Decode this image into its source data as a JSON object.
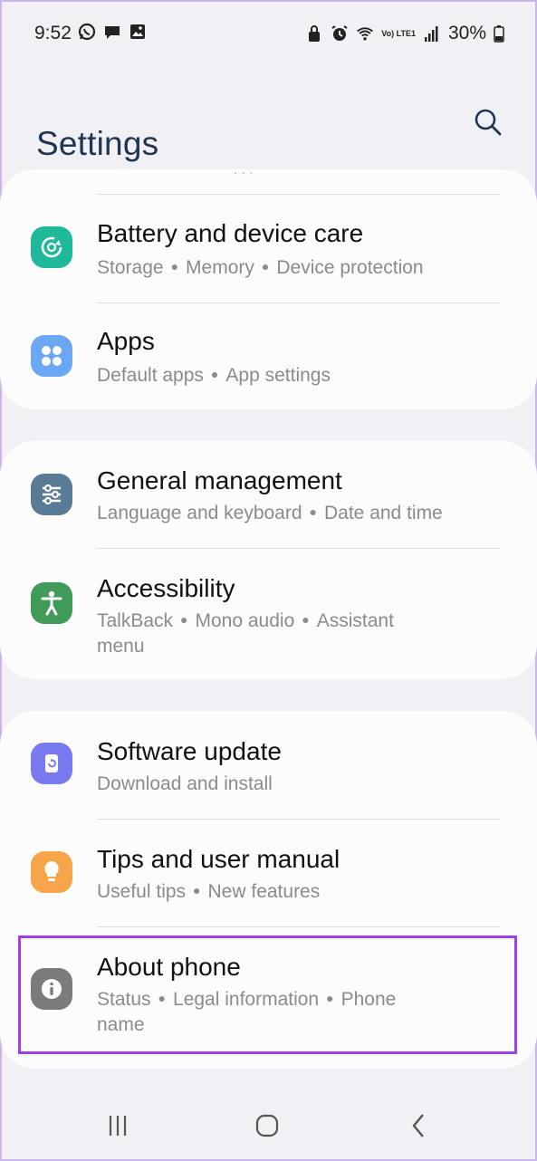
{
  "status_bar": {
    "time": "9:52",
    "battery": "30%",
    "network_label": "Vo) LTE1",
    "icons_left": [
      "whatsapp-icon",
      "chat-icon",
      "gallery-icon"
    ],
    "icons_right": [
      "lock-icon",
      "alarm-icon",
      "wifi-icon",
      "volte-icon",
      "signal-icon",
      "battery-icon"
    ]
  },
  "header": {
    "title": "Settings",
    "search_icon": "search-icon"
  },
  "colors": {
    "battery": "#1fb99a",
    "apps": "#6aa8f4",
    "general": "#5a7b95",
    "accessibility": "#3f9b57",
    "software": "#7a7af0",
    "tips": "#f6a54a",
    "about": "#7b7b7b",
    "highlight": "#a13fe8"
  },
  "sections": [
    {
      "items": [
        {
          "title": "Battery and device care",
          "subs": [
            "Storage",
            "Memory",
            "Device protection"
          ],
          "icon": "device-care-icon"
        },
        {
          "title": "Apps",
          "subs": [
            "Default apps",
            "App settings"
          ],
          "icon": "apps-grid-icon"
        }
      ]
    },
    {
      "items": [
        {
          "title": "General management",
          "subs": [
            "Language and keyboard",
            "Date and time"
          ],
          "icon": "sliders-icon"
        },
        {
          "title": "Accessibility",
          "subs": [
            "TalkBack",
            "Mono audio",
            "Assistant"
          ],
          "sub2": "menu",
          "icon": "accessibility-person-icon"
        }
      ]
    },
    {
      "items": [
        {
          "title": "Software update",
          "subs": [
            "Download and install"
          ],
          "icon": "update-icon"
        },
        {
          "title": "Tips and user manual",
          "subs": [
            "Useful tips",
            "New features"
          ],
          "icon": "lightbulb-icon"
        },
        {
          "title": "About phone",
          "subs": [
            "Status",
            "Legal information",
            "Phone"
          ],
          "sub2": "name",
          "icon": "info-icon"
        }
      ]
    }
  ],
  "nav_bar": {
    "recents_icon": "recents-icon",
    "home_icon": "home-icon",
    "back_icon": "back-icon"
  }
}
